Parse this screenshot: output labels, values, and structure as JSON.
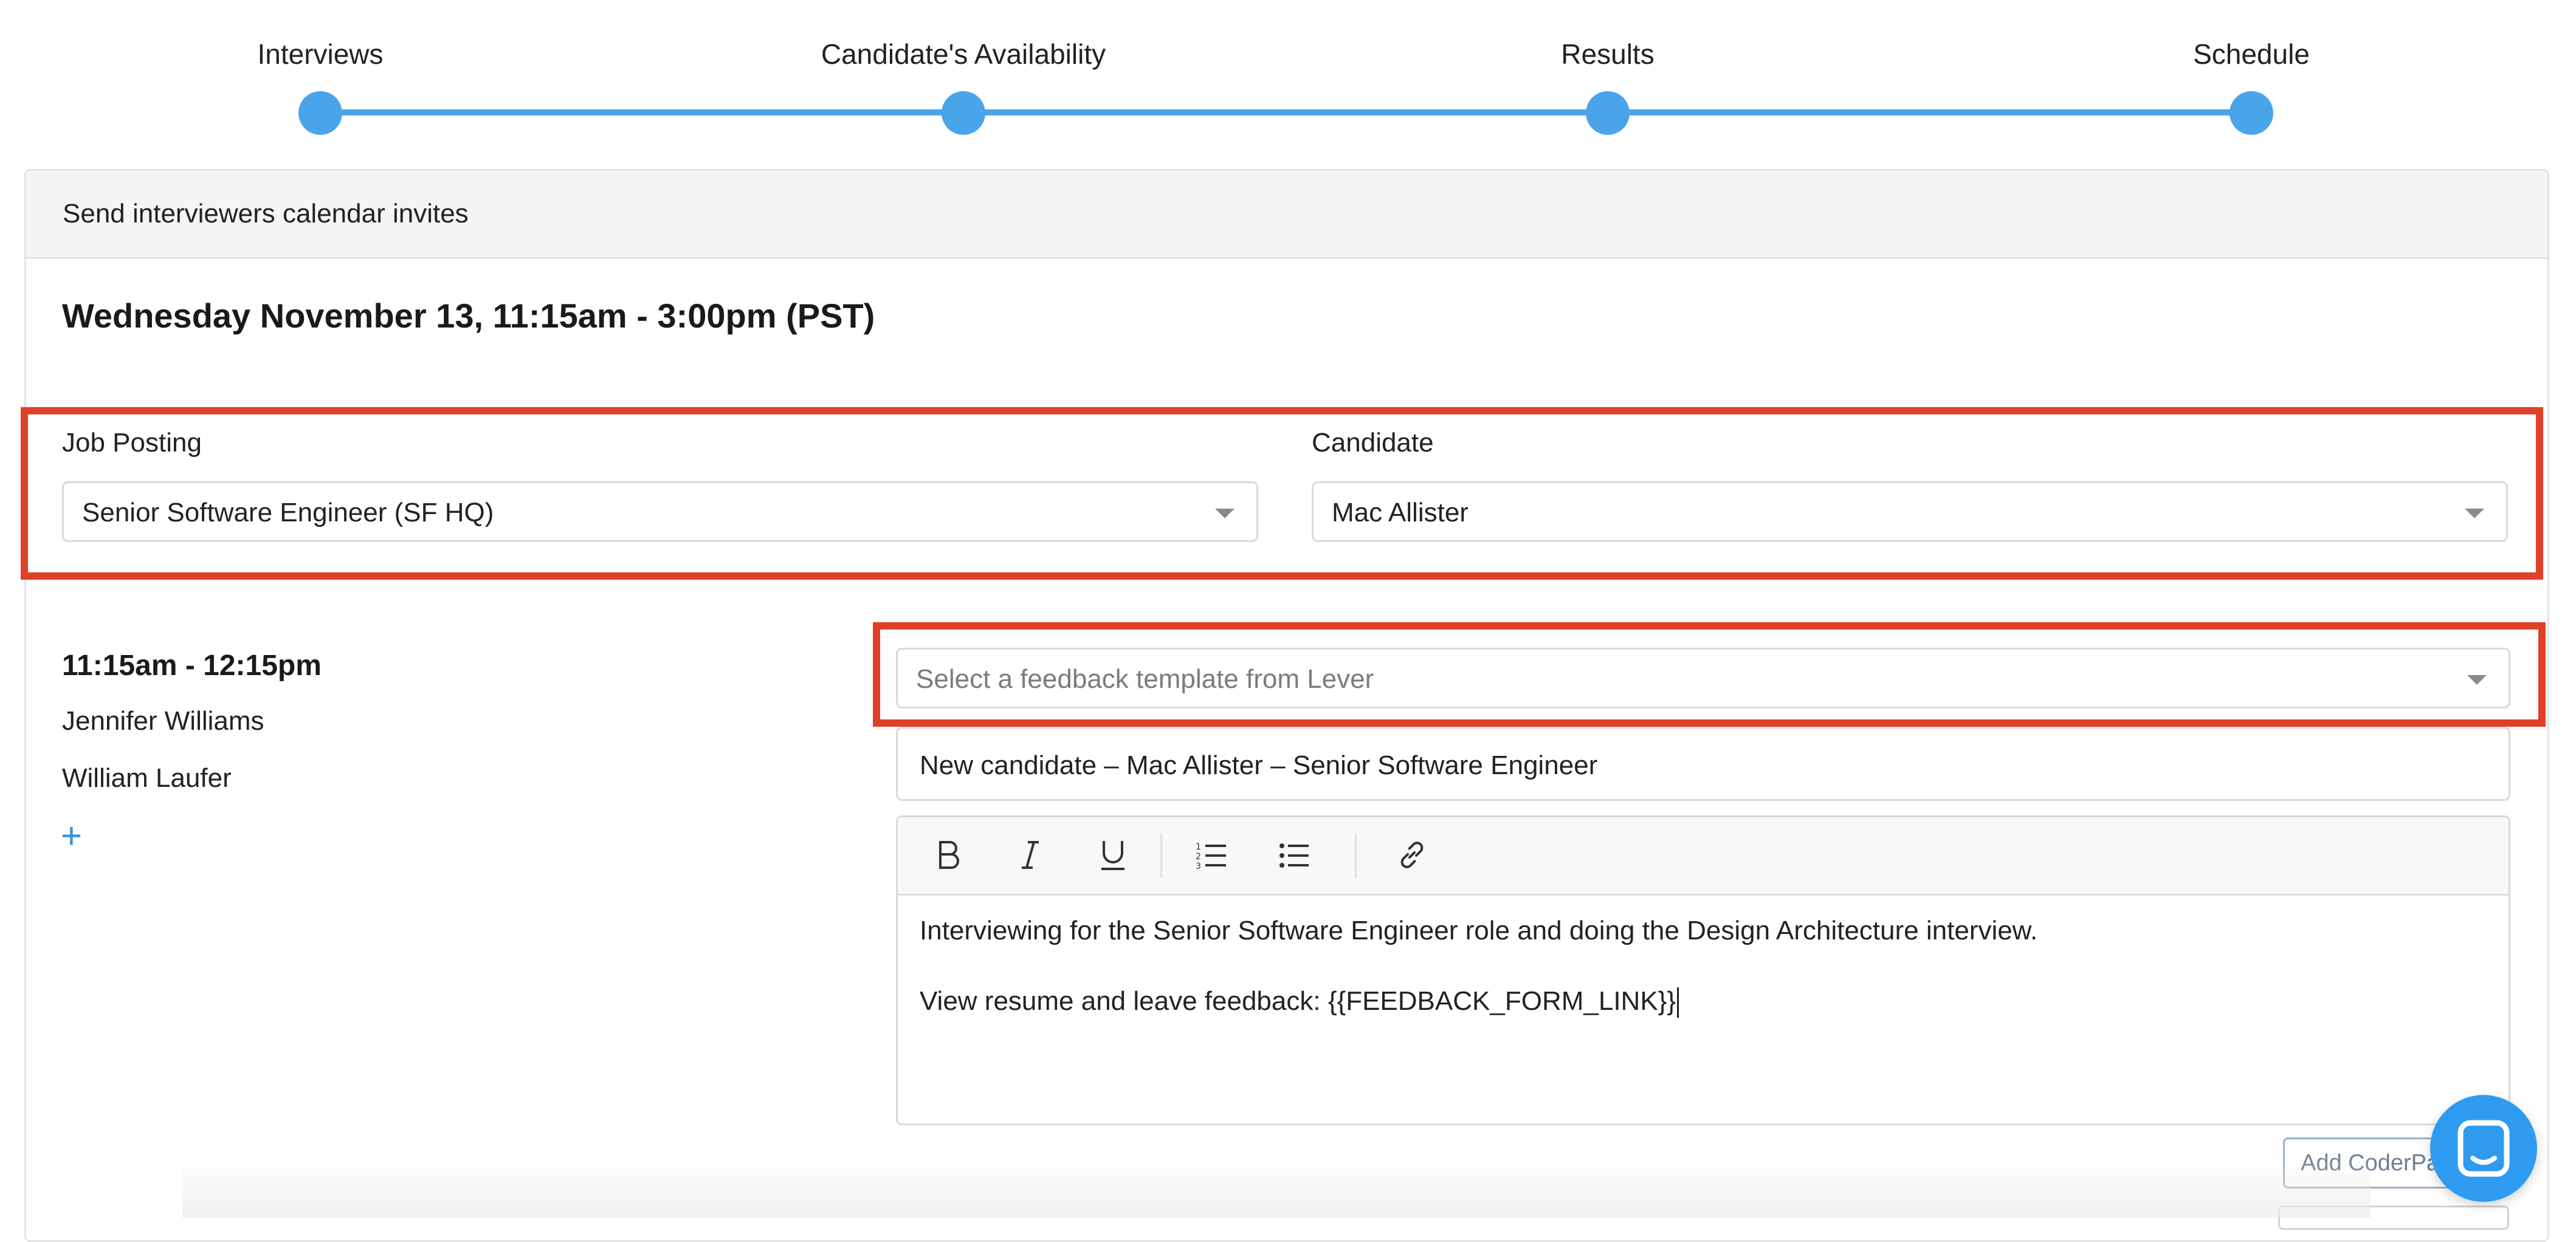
{
  "stepper": {
    "steps": [
      {
        "label": "Interviews"
      },
      {
        "label": "Candidate's Availability"
      },
      {
        "label": "Results"
      },
      {
        "label": "Schedule"
      }
    ],
    "accent_color": "#4aa4ea"
  },
  "card": {
    "header": "Send interviewers calendar invites",
    "date_title": "Wednesday November 13, 11:15am - 3:00pm (PST)"
  },
  "form": {
    "job_posting": {
      "label": "Job Posting",
      "value": "Senior Software Engineer (SF HQ)"
    },
    "candidate": {
      "label": "Candidate",
      "value": "Mac Allister"
    }
  },
  "interview": {
    "time": "11:15am - 12:15pm",
    "interviewers": [
      "Jennifer Williams",
      "William Laufer"
    ],
    "add_label": "+",
    "feedback_template": {
      "placeholder": "Select a feedback template from Lever"
    },
    "subject": "New candidate – Mac Allister – Senior Software Engineer",
    "toolbar": [
      "bold-icon",
      "italic-icon",
      "underline-icon",
      "ordered-list-icon",
      "bullet-list-icon",
      "link-icon"
    ],
    "body_lines": [
      "Interviewing for the Senior Software Engineer role and doing the Design Architecture interview.",
      "View resume and leave feedback: {{FEEDBACK_FORM_LINK}}"
    ],
    "coderpad_button": "Add CoderPad"
  },
  "highlight_color": "#e0402a",
  "chat_icon": "chat-bubble-icon"
}
